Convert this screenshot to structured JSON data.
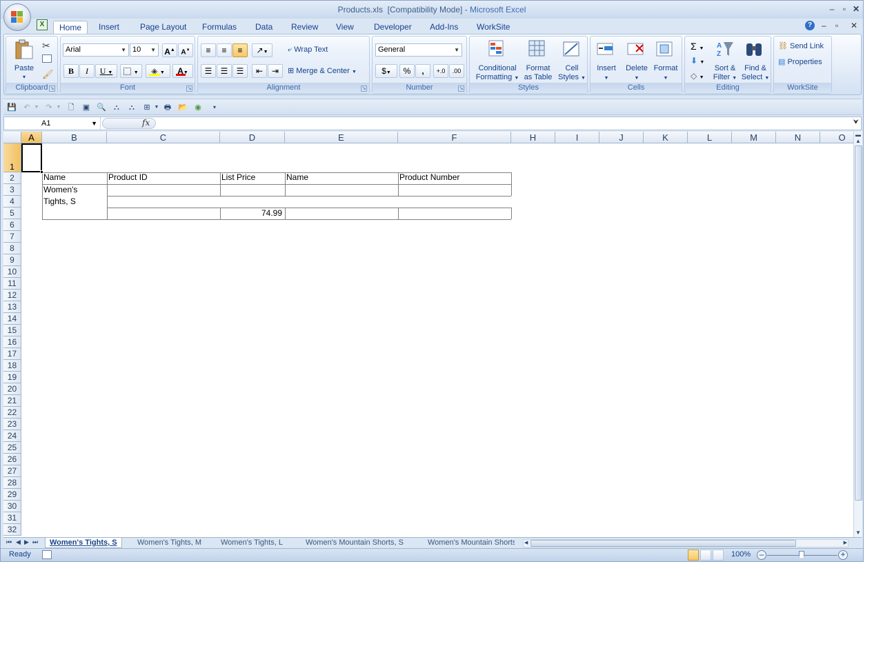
{
  "window": {
    "filename": "Products.xls",
    "mode": "[Compatibility Mode]",
    "app": "Microsoft Excel"
  },
  "tabs": [
    "Home",
    "Insert",
    "Page Layout",
    "Formulas",
    "Data",
    "Review",
    "View",
    "Developer",
    "Add-Ins",
    "WorkSite"
  ],
  "active_tab": "Home",
  "ribbon": {
    "clipboard": {
      "label": "Clipboard",
      "paste": "Paste"
    },
    "font": {
      "label": "Font",
      "font_name": "Arial",
      "font_size": "10",
      "bold": "B",
      "italic": "I",
      "underline": "U",
      "grow": "A",
      "shrink": "A",
      "fontcolor": "A"
    },
    "alignment": {
      "label": "Alignment",
      "wrap_text": "Wrap Text",
      "merge_center": "Merge & Center"
    },
    "number": {
      "label": "Number",
      "format": "General",
      "percent": "%",
      "comma": ","
    },
    "styles": {
      "label": "Styles",
      "conditional": [
        "Conditional",
        "Formatting"
      ],
      "format_table": [
        "Format",
        "as Table"
      ],
      "cell_styles": [
        "Cell",
        "Styles"
      ]
    },
    "cells": {
      "label": "Cells",
      "insert": "Insert",
      "delete": "Delete",
      "format": "Format"
    },
    "editing": {
      "label": "Editing",
      "sort": [
        "Sort &",
        "Filter"
      ],
      "find": [
        "Find &",
        "Select"
      ]
    },
    "worksite": {
      "label": "WorkSite",
      "send_link": "Send Link",
      "properties": "Properties"
    }
  },
  "formula_bar": {
    "name_box": "A1",
    "fx": "fx",
    "value": ""
  },
  "columns": [
    "A",
    "B",
    "C",
    "D",
    "E",
    "F",
    "H",
    "I",
    "J",
    "K",
    "L",
    "M",
    "N",
    "O"
  ],
  "rows": [
    "1",
    "2",
    "3",
    "4",
    "5",
    "6",
    "7",
    "8",
    "9",
    "10",
    "11",
    "12",
    "13",
    "14",
    "15",
    "16",
    "17",
    "18",
    "19",
    "20",
    "21",
    "22",
    "23",
    "24",
    "25",
    "26",
    "27",
    "28",
    "29",
    "30",
    "31",
    "32"
  ],
  "cells": {
    "B2": "Name",
    "C2": "Product ID",
    "D2": "List Price",
    "E2": "Name",
    "F2": "Product Number",
    "B3_line1": "Women's",
    "B3_line2": "Tights, S",
    "D5": "74.99"
  },
  "sheets": [
    "Women's Tights, S",
    "Women's Tights, M",
    "Women's Tights, L",
    "Women's Mountain Shorts, S",
    "Women's Mountain Shorts"
  ],
  "active_sheet": "Women's Tights, S",
  "status": {
    "ready": "Ready",
    "zoom": "100%"
  }
}
